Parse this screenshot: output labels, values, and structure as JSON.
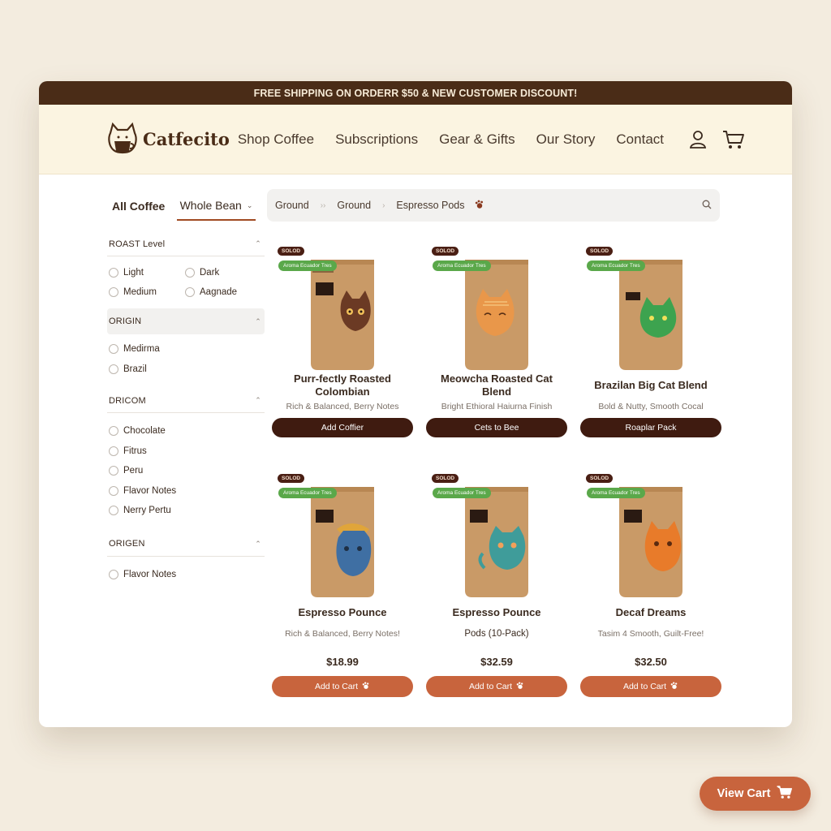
{
  "promo_bar": {
    "text": "FREE SHIPPING ON ORDERR $50 & NEW CUSTOMER DISCOUNT!"
  },
  "brand": {
    "name": "Catfecito",
    "logo_icon": "cat-coffee-cup-icon"
  },
  "nav": {
    "items": [
      "Shop Coffee",
      "Subscriptions",
      "Gear & Gifts",
      "Our Story",
      "Contact"
    ],
    "account_icon": "user-icon",
    "cart_icon": "cart-icon"
  },
  "filter_tabs": {
    "all": "All Coffee",
    "whole_bean": "Whole Bean",
    "chips": [
      "Ground",
      "Ground",
      "Espresso Pods"
    ],
    "search_icon": "search-icon"
  },
  "sidebar": {
    "roast": {
      "title": "ROAST Level",
      "options": [
        "Light",
        "Dark",
        "Medium",
        "Aagnade"
      ]
    },
    "origin": {
      "title": "ORIGIN",
      "options": [
        "Medirma",
        "Brazil"
      ]
    },
    "dricom": {
      "title": "DRICOM",
      "options": [
        "Chocolate",
        "Fitrus",
        "Peru",
        "Flavor Notes",
        "Nerry Pertu"
      ]
    },
    "origen": {
      "title": "ORIGEN",
      "options": [
        "Flavor Notes"
      ]
    }
  },
  "products": [
    {
      "badge": "SOLOD",
      "promo": "Aroma Ecuador Tres",
      "name": "Purr-fectly Roasted Colombian",
      "desc": "Rich & Balanced, Berry Notes",
      "price": "",
      "button": "Add Coffier",
      "cat_color": "#6b3a24",
      "bag_color": "#c99a67"
    },
    {
      "badge": "SOLOD",
      "promo": "Aroma Ecuador Tres",
      "name": "Meowcha Roasted Cat Blend",
      "desc": "Bright Ethioral Haiurna Finish",
      "price": "",
      "button": "Cets to Bee",
      "cat_color": "#e9974a",
      "bag_color": "#c99a67"
    },
    {
      "badge": "SOLOD",
      "promo": "Aroma Ecuador Tres",
      "name": "Brazilan Big Cat Blend",
      "desc": "Bold & Nutty, Smooth Cocal",
      "price": "",
      "button": "Roaplar Pack",
      "cat_color": "#3da34f",
      "bag_color": "#c99a67"
    },
    {
      "badge": "SOLOD",
      "promo": "Aroma Ecuador Tres",
      "name": "Espresso Pounce",
      "desc": "Rich & Balanced, Berry Notes!",
      "price": "$18.99",
      "button": "Add to Cart",
      "cat_color": "#3f6fa3",
      "bag_color": "#c99a67"
    },
    {
      "badge": "SOLOD",
      "promo": "Aroma Ecuador Tres",
      "name": "Espresso Pounce",
      "desc": "Pods (10-Pack)",
      "price": "$32.59",
      "button": "Add to Cart",
      "cat_color": "#3f9c9a",
      "bag_color": "#c99a67"
    },
    {
      "badge": "SOLOD",
      "promo": "Aroma Ecuador Tres",
      "name": "Decaf Dreams",
      "desc": "Tasim 4 Smooth, Guilt-Free!",
      "price": "$32.50",
      "button": "Add to Cart",
      "cat_color": "#e87b2a",
      "bag_color": "#c99a67"
    }
  ],
  "view_cart": {
    "label": "View Cart",
    "icon": "cart-icon"
  },
  "colors": {
    "brand_dark": "#4a2c17",
    "accent_orange": "#c8643d",
    "button_dark": "#3f1b10",
    "promo_green": "#5aa84a"
  }
}
